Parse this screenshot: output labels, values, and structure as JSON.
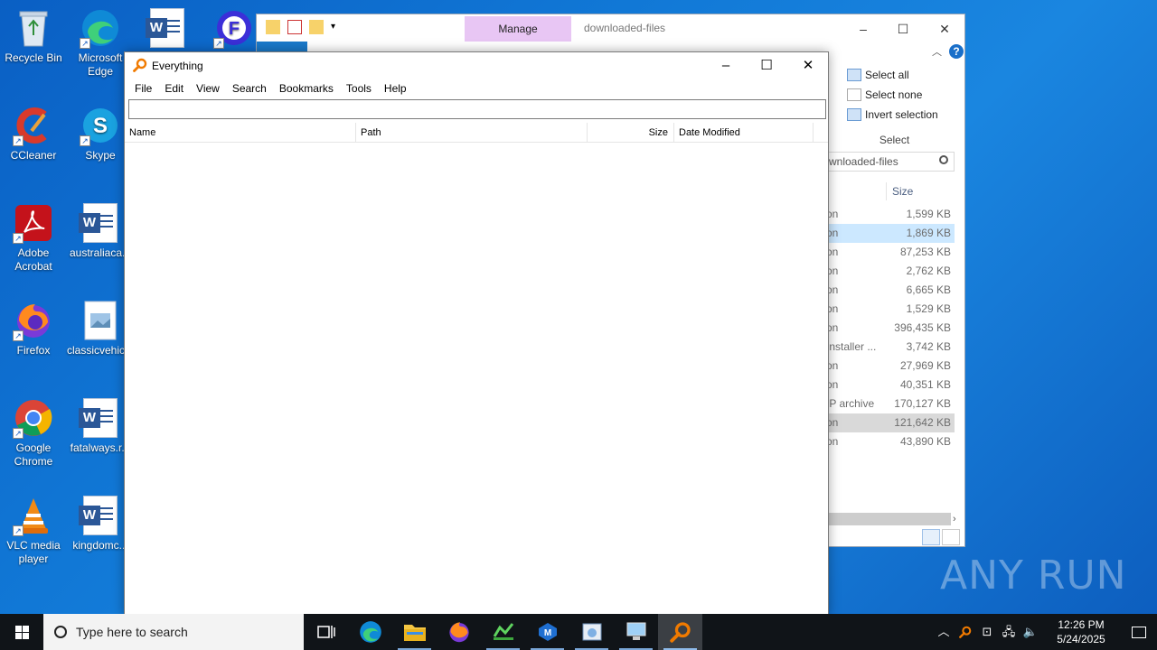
{
  "desktop": {
    "icons": [
      {
        "label": "Recycle Bin"
      },
      {
        "label": "Microsoft Edge"
      },
      {
        "label": "CCleaner"
      },
      {
        "label": "Skype"
      },
      {
        "label": "Adobe Acrobat"
      },
      {
        "label": "australiaca..."
      },
      {
        "label": "Firefox"
      },
      {
        "label": "classicvehic..."
      },
      {
        "label": "Google Chrome"
      },
      {
        "label": "fatalways.r..."
      },
      {
        "label": "VLC media player"
      },
      {
        "label": "kingdomc..."
      }
    ]
  },
  "explorer": {
    "title": "downloaded-files",
    "manage_tab": "Manage",
    "ribbon": {
      "select_all": "Select all",
      "select_none": "Select none",
      "invert_selection": "Invert selection",
      "group_label": "Select"
    },
    "address": "wnloaded-files",
    "size_header": "Size",
    "rows": [
      {
        "type": "on",
        "size": "1,599 KB"
      },
      {
        "type": "on",
        "size": "1,869 KB"
      },
      {
        "type": "on",
        "size": "87,253 KB"
      },
      {
        "type": "on",
        "size": "2,762 KB"
      },
      {
        "type": "on",
        "size": "6,665 KB"
      },
      {
        "type": "on",
        "size": "1,529 KB"
      },
      {
        "type": "on",
        "size": "396,435 KB"
      },
      {
        "type": "Installer ...",
        "size": "3,742 KB"
      },
      {
        "type": "on",
        "size": "27,969 KB"
      },
      {
        "type": "on",
        "size": "40,351 KB"
      },
      {
        "type": "IP archive",
        "size": "170,127 KB"
      },
      {
        "type": "on",
        "size": "121,642 KB"
      },
      {
        "type": "on",
        "size": "43,890 KB"
      }
    ]
  },
  "everything": {
    "title": "Everything",
    "menu": [
      "File",
      "Edit",
      "View",
      "Search",
      "Bookmarks",
      "Tools",
      "Help"
    ],
    "search_value": "",
    "columns": {
      "name": "Name",
      "path": "Path",
      "size": "Size",
      "date": "Date Modified"
    }
  },
  "taskbar": {
    "search_placeholder": "Type here to search",
    "time": "12:26 PM",
    "date": "5/24/2025"
  },
  "watermark": "ANY RUN"
}
